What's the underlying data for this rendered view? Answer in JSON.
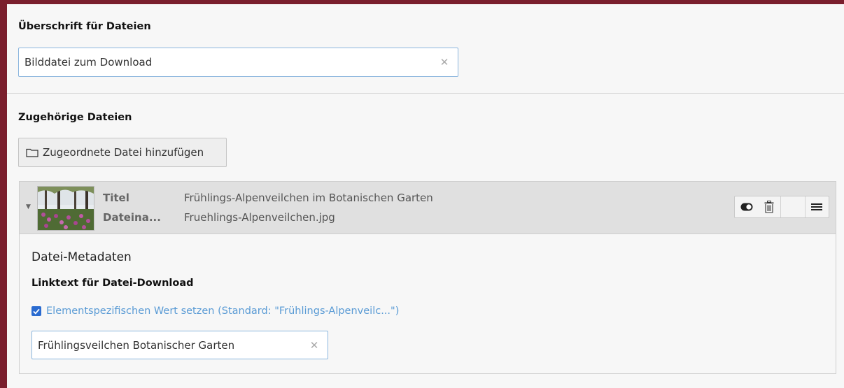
{
  "heading_field": {
    "label": "Überschrift für Dateien",
    "value": "Bilddatei zum Download"
  },
  "related_files": {
    "label": "Zugehörige Dateien",
    "add_button_label": "Zugeordnete Datei hinzufügen",
    "file": {
      "title_key": "Titel",
      "title_value": "Frühlings-Alpenveilchen im Botanischen Garten",
      "filename_key": "Dateina...",
      "filename_value": "Fruehlings-Alpenveilchen.jpg",
      "metadata_heading": "Datei-Metadaten",
      "linktext_label": "Linktext für Datei-Download",
      "override_checkbox_label": "Elementspezifischen Wert setzen (Standard: \"Frühlings-Alpenveilc...\")",
      "override_checked": true,
      "linktext_value": "Frühlingsveilchen Botanischer Garten"
    }
  },
  "icons": {
    "clear": "close-icon",
    "folder": "folder-icon",
    "expand": "caret-down-icon",
    "toggle": "toggle-visibility-icon",
    "delete": "trash-icon",
    "drag": "drag-handle-icon",
    "checkbox": "check-icon"
  },
  "colors": {
    "frame": "#7a1f2d",
    "link_blue": "#5a9bd5",
    "checkbox_blue": "#2a6bd0",
    "input_border": "#8bb6de"
  }
}
